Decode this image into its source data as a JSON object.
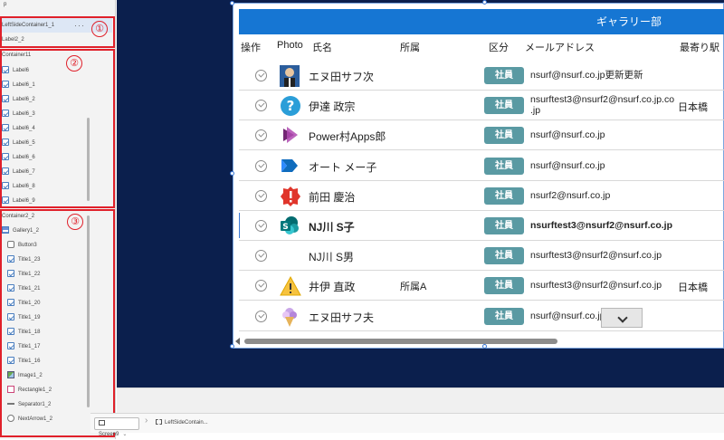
{
  "tree": {
    "partial_top": "p",
    "root": "LeftSideContainer1_1",
    "label2": "Label2_2",
    "container11": "Container11",
    "labels": [
      "Label6",
      "Label6_1",
      "Label6_2",
      "Label6_3",
      "Label6_4",
      "Label6_5",
      "Label6_6",
      "Label6_7",
      "Label6_8",
      "Label6_9"
    ],
    "container2": "Container2_2",
    "gallery": "Gallery1_2",
    "button": "Button3",
    "titles": [
      "Title1_23",
      "Title1_22",
      "Title1_21",
      "Title1_20",
      "Title1_19",
      "Title1_18",
      "Title1_17",
      "Title1_16"
    ],
    "image": "Image1_2",
    "rect": "Rectangle1_2",
    "separator": "Separator1_2",
    "nextarrow": "NextArrow1_2",
    "dots": "···"
  },
  "callouts": [
    "①",
    "②",
    "③"
  ],
  "gallery_header": "ギャラリー部",
  "columns": {
    "op": "操作",
    "photo": "Photo",
    "name": "氏名",
    "dept": "所属",
    "kubun": "区分",
    "email": "メールアドレス",
    "station": "最寄り駅"
  },
  "rows": [
    {
      "name": "エヌ田サフ次",
      "dept": "",
      "badge": "社員",
      "email": "nsurf@nsurf.co.jp更新更新",
      "station": "",
      "photo": "person-photo",
      "bold": false
    },
    {
      "name": "伊達 政宗",
      "dept": "",
      "badge": "社員",
      "email": "nsurftest3@nsurf2@nsurf.co.jp.co\n.jp",
      "station": "日本橋",
      "photo": "question-icon",
      "bold": false
    },
    {
      "name": "Power村Apps郎",
      "dept": "",
      "badge": "社員",
      "email": "nsurf@nsurf.co.jp",
      "station": "",
      "photo": "power-apps-icon",
      "bold": false
    },
    {
      "name": "オート メー子",
      "dept": "",
      "badge": "社員",
      "email": "nsurf@nsurf.co.jp",
      "station": "",
      "photo": "power-automate-icon",
      "bold": false
    },
    {
      "name": "前田 慶治",
      "dept": "",
      "badge": "社員",
      "email": "nsurf2@nsurf.co.jp",
      "station": "",
      "photo": "error-badge-icon",
      "bold": false
    },
    {
      "name": "NJ川 S子",
      "dept": "",
      "badge": "社員",
      "email": "nsurftest3@nsurf2@nsurf.co.jp",
      "station": "",
      "photo": "sharepoint-icon",
      "bold": true
    },
    {
      "name": "NJ川 S男",
      "dept": "",
      "badge": "社員",
      "email": "nsurftest3@nsurf2@nsurf.co.jp",
      "station": "",
      "photo": "",
      "bold": false
    },
    {
      "name": "井伊 直政",
      "dept": "所属A",
      "badge": "社員",
      "email": "nsurftest3@nsurf2@nsurf.co.jp",
      "station": "日本橋",
      "photo": "warning-icon",
      "bold": false
    },
    {
      "name": "エヌ田サフ夫",
      "dept": "",
      "badge": "社員",
      "email": "nsurf@nsurf.co.jp",
      "station": "",
      "photo": "ice-cream-icon",
      "bold": false
    }
  ],
  "bottom_bar": {
    "screen_tab": "Screen9",
    "container_tab": "LeftSideContain..."
  },
  "colors": {
    "header_blue": "#1676d3",
    "badge_teal": "#5a9aa3",
    "canvas_navy": "#0b1f4d",
    "callout_red": "#e0202a"
  }
}
